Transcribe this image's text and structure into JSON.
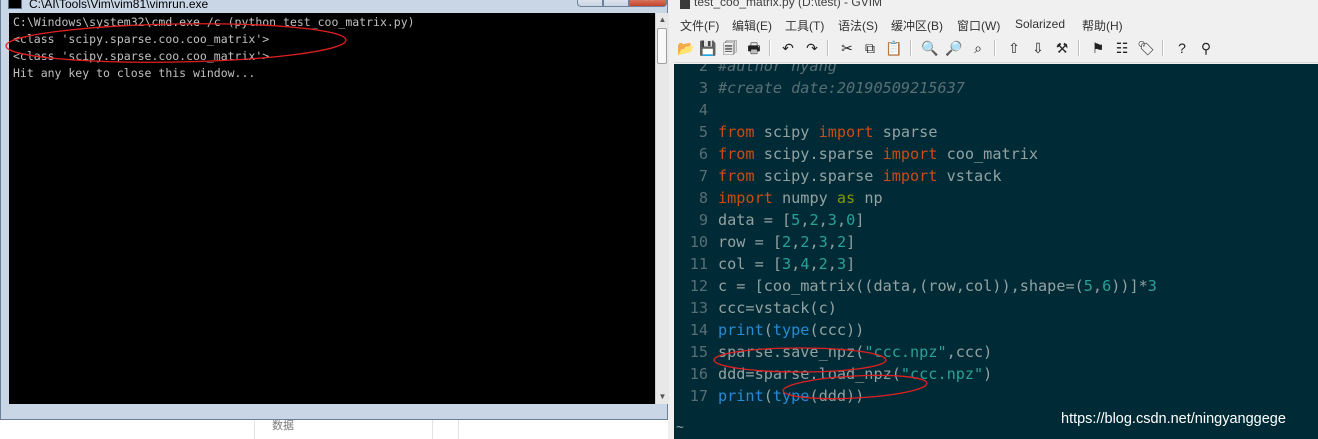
{
  "background_app": {
    "label": "数据"
  },
  "cmd": {
    "title": "C:\\AI\\Tools\\Vim\\vim81\\vimrun.exe",
    "icon": "console-icon",
    "lines": [
      "C:\\Windows\\system32\\cmd.exe /c (python test_coo_matrix.py)",
      "<class 'scipy.sparse.coo.coo_matrix'>",
      "<class 'scipy.sparse.coo.coo_matrix'>",
      "Hit any key to close this window..."
    ]
  },
  "gvim": {
    "title": "test_coo_matrix.py (D:\\test) - GVIM",
    "menu": [
      "文件(F)",
      "编辑(E)",
      "工具(T)",
      "语法(S)",
      "缓冲区(B)",
      "窗口(W)",
      "Solarized",
      "帮助(H)"
    ],
    "toolbar_icons": [
      "open-icon",
      "save-icon",
      "save-all-icon",
      "print-icon",
      "undo-icon",
      "redo-icon",
      "cut-icon",
      "copy-icon",
      "paste-icon",
      "find-icon",
      "find-next-icon",
      "find-prev-icon",
      "load-session-icon",
      "save-session-icon",
      "run-script-icon",
      "make-icon",
      "build-tags-icon",
      "jump-tag-icon",
      "help-icon",
      "find-help-icon"
    ],
    "code_lines": [
      {
        "n": "2",
        "tokens": [
          [
            "#author nyang",
            "comment"
          ]
        ]
      },
      {
        "n": "3",
        "tokens": [
          [
            "#create date:20190509215637",
            "comment"
          ]
        ]
      },
      {
        "n": "4",
        "tokens": []
      },
      {
        "n": "5",
        "tokens": [
          [
            "from",
            "kw"
          ],
          [
            " scipy ",
            "plain"
          ],
          [
            "import",
            "kw"
          ],
          [
            " sparse",
            "plain"
          ]
        ]
      },
      {
        "n": "6",
        "tokens": [
          [
            "from",
            "kw"
          ],
          [
            " scipy.sparse ",
            "plain"
          ],
          [
            "import",
            "kw"
          ],
          [
            " coo_matrix",
            "plain"
          ]
        ]
      },
      {
        "n": "7",
        "tokens": [
          [
            "from",
            "kw"
          ],
          [
            " scipy.sparse ",
            "plain"
          ],
          [
            "import",
            "kw"
          ],
          [
            " vstack",
            "plain"
          ]
        ]
      },
      {
        "n": "8",
        "tokens": [
          [
            "import",
            "kw"
          ],
          [
            " numpy ",
            "plain"
          ],
          [
            "as",
            "as"
          ],
          [
            " np",
            "plain"
          ]
        ]
      },
      {
        "n": "9",
        "tokens": [
          [
            "data = [",
            "plain"
          ],
          [
            "5",
            "num"
          ],
          [
            ",",
            "plain"
          ],
          [
            "2",
            "num"
          ],
          [
            ",",
            "plain"
          ],
          [
            "3",
            "num"
          ],
          [
            ",",
            "plain"
          ],
          [
            "0",
            "num"
          ],
          [
            "]",
            "plain"
          ]
        ]
      },
      {
        "n": "10",
        "tokens": [
          [
            "row = [",
            "plain"
          ],
          [
            "2",
            "num"
          ],
          [
            ",",
            "plain"
          ],
          [
            "2",
            "num"
          ],
          [
            ",",
            "plain"
          ],
          [
            "3",
            "num"
          ],
          [
            ",",
            "plain"
          ],
          [
            "2",
            "num"
          ],
          [
            "]",
            "plain"
          ]
        ]
      },
      {
        "n": "11",
        "tokens": [
          [
            "col = [",
            "plain"
          ],
          [
            "3",
            "num"
          ],
          [
            ",",
            "plain"
          ],
          [
            "4",
            "num"
          ],
          [
            ",",
            "plain"
          ],
          [
            "2",
            "num"
          ],
          [
            ",",
            "plain"
          ],
          [
            "3",
            "num"
          ],
          [
            "]",
            "plain"
          ]
        ]
      },
      {
        "n": "12",
        "tokens": [
          [
            "c = [coo_matrix((data,(row,col)),shape=(",
            "plain"
          ],
          [
            "5",
            "num"
          ],
          [
            ",",
            "plain"
          ],
          [
            "6",
            "num"
          ],
          [
            "))]*",
            "plain"
          ],
          [
            "3",
            "num"
          ]
        ]
      },
      {
        "n": "13",
        "tokens": [
          [
            "ccc=vstack(c)",
            "plain"
          ]
        ]
      },
      {
        "n": "14",
        "tokens": [
          [
            "print",
            "fn"
          ],
          [
            "(",
            "plain"
          ],
          [
            "type",
            "fn"
          ],
          [
            "(ccc))",
            "plain"
          ]
        ]
      },
      {
        "n": "15",
        "tokens": [
          [
            "sparse.save_npz(",
            "plain"
          ],
          [
            "\"ccc.npz\"",
            "str"
          ],
          [
            ",ccc)",
            "plain"
          ]
        ]
      },
      {
        "n": "16",
        "tokens": [
          [
            "ddd=sparse.load_npz(",
            "plain"
          ],
          [
            "\"ccc.npz\"",
            "str"
          ],
          [
            ")",
            "plain"
          ]
        ]
      },
      {
        "n": "17",
        "tokens": [
          [
            "print",
            "fn"
          ],
          [
            "(",
            "plain"
          ],
          [
            "type",
            "fn"
          ],
          [
            "(ddd))",
            "plain"
          ]
        ]
      }
    ],
    "cmdline": "~"
  },
  "colors": {
    "solarized_base03": "#002b36",
    "solarized_base1": "#93a1a1",
    "solarized_orange": "#cb4b16",
    "solarized_cyan": "#2aa198",
    "solarized_blue": "#268bd2",
    "solarized_green": "#859900",
    "annotation_red": "#e02020"
  },
  "watermark": "https://blog.csdn.net/ningyanggege"
}
